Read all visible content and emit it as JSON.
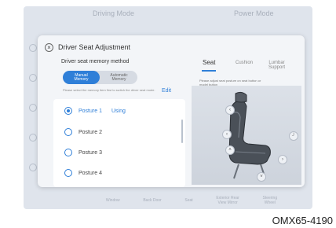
{
  "background": {
    "tabs": [
      "Driving Mode",
      "Power Mode"
    ],
    "bottom_items": [
      "Window",
      "Back Door",
      "Seat",
      "Exterior Rear\nView Mirror",
      "Steering\nWheel"
    ]
  },
  "dialog": {
    "title": "Driver Seat Adjustment",
    "memory_method_label": "Driver seat memory method",
    "method_options": [
      "Manual\nMemory",
      "Automatic\nMemory"
    ],
    "selected_method": "Manual Memory",
    "hint": "Please select the memory item first to switch the driver seat mode.",
    "edit_label": "Edit",
    "postures": [
      {
        "label": "Posture 1",
        "status": "Using",
        "selected": true
      },
      {
        "label": "Posture 2",
        "status": "",
        "selected": false
      },
      {
        "label": "Posture 3",
        "status": "",
        "selected": false
      },
      {
        "label": "Posture 4",
        "status": "",
        "selected": false
      }
    ],
    "right_tabs": [
      "Seat",
      "Cushion",
      "Lumbar\nSupport"
    ],
    "active_tab": "Seat",
    "instruction": "Please adjust seat posture on seat button or model button"
  },
  "code_label": "OMX65-4190",
  "colors": {
    "accent": "#2f7fd8",
    "dialog_bg": "#f3f5f8",
    "screen_bg": "#dfe4ec"
  }
}
